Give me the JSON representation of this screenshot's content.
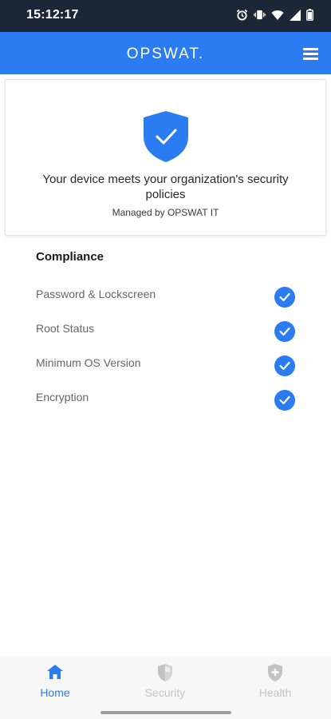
{
  "status_bar": {
    "time": "15:12:17",
    "icons": [
      "alarm-icon",
      "vibrate-icon",
      "wifi-icon",
      "signal-icon",
      "battery-icon"
    ]
  },
  "header": {
    "logo_text": "OPSWAT.",
    "menu_icon": "hamburger-menu-icon",
    "background": "#2b7bf1"
  },
  "status_card": {
    "icon": "shield-check-icon",
    "message": "Your device meets your organization's security policies",
    "managed_by": "Managed by OPSWAT IT"
  },
  "compliance": {
    "title": "Compliance",
    "items": [
      {
        "label": "Password & Lockscreen",
        "status": "compliant",
        "icon": "check-icon"
      },
      {
        "label": "Root Status",
        "status": "compliant",
        "icon": "check-icon"
      },
      {
        "label": "Minimum OS Version",
        "status": "compliant",
        "icon": "check-icon"
      },
      {
        "label": "Encryption",
        "status": "compliant",
        "icon": "check-icon"
      }
    ]
  },
  "bottom_nav": {
    "items": [
      {
        "label": "Home",
        "icon": "home-icon",
        "active": true
      },
      {
        "label": "Security",
        "icon": "shield-icon",
        "active": false
      },
      {
        "label": "Health",
        "icon": "shield-plus-icon",
        "active": false
      }
    ]
  },
  "colors": {
    "accent": "#2b7bf1",
    "status_bar": "#1b2636",
    "inactive": "#c3c3c3"
  }
}
